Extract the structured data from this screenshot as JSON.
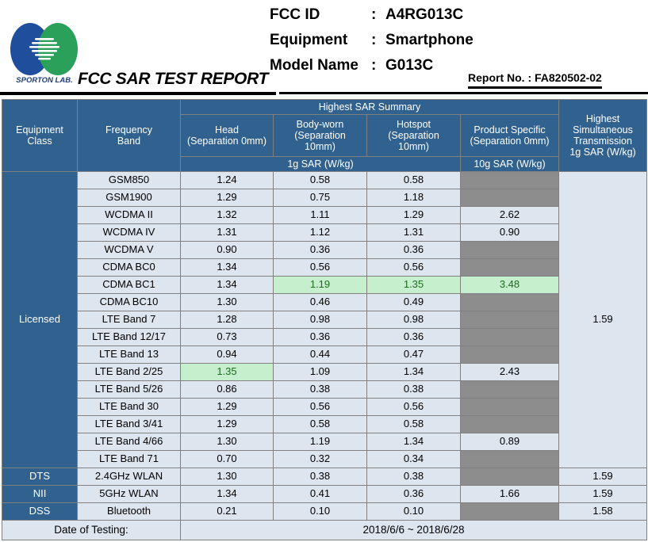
{
  "header": {
    "logo_text": "SPORTON LAB.",
    "logo_colors": {
      "blue": "#1f4e9c",
      "green": "#2aa05a"
    },
    "report_title": "FCC SAR TEST REPORT",
    "info": [
      {
        "label": "FCC ID",
        "colon": ":",
        "value": "A4RG013C"
      },
      {
        "label": "Equipment",
        "colon": ":",
        "value": "Smartphone"
      },
      {
        "label": "Model Name",
        "colon": ":",
        "value": "G013C"
      }
    ],
    "report_no": "Report No. : FA820502-02"
  },
  "table": {
    "group_header": "Highest SAR Summary",
    "columns": {
      "equipment_class": "Equipment\nClass",
      "equipment_class_l1": "Equipment",
      "equipment_class_l2": "Class",
      "frequency_band_l1": "Frequency",
      "frequency_band_l2": "Band",
      "head_l1": "Head",
      "head_l2": "(Separation 0mm)",
      "bodyworn_l1": "Body-worn",
      "bodyworn_l2": "(Separation",
      "bodyworn_l3": "10mm)",
      "hotspot_l1": "Hotspot",
      "hotspot_l2": "(Separation",
      "hotspot_l3": "10mm)",
      "product_specific_l1": "Product Specific",
      "product_specific_l2": "(Separation 0mm)",
      "simultaneous_l1": "Highest",
      "simultaneous_l2": "Simultaneous",
      "simultaneous_l3": "Transmission",
      "simultaneous_l4": "1g SAR (W/kg)"
    },
    "unit_1g": "1g SAR (W/kg)",
    "unit_10g": "10g SAR (W/kg)",
    "classes": {
      "licensed": "Licensed",
      "dts": "DTS",
      "nii": "NII",
      "dss": "DSS"
    },
    "simultaneous_values": {
      "licensed": "1.59",
      "dts": "1.59",
      "nii": "1.59",
      "dss": "1.58"
    },
    "rows": [
      {
        "band": "GSM850",
        "head": "1.24",
        "body": "0.58",
        "hotspot": "0.58",
        "product": "",
        "product_gray": true
      },
      {
        "band": "GSM1900",
        "head": "1.29",
        "body": "0.75",
        "hotspot": "1.18",
        "product": "",
        "product_gray": true
      },
      {
        "band": "WCDMA II",
        "head": "1.32",
        "body": "1.11",
        "hotspot": "1.29",
        "product": "2.62",
        "product_gray": false
      },
      {
        "band": "WCDMA IV",
        "head": "1.31",
        "body": "1.12",
        "hotspot": "1.31",
        "product": "0.90",
        "product_gray": false
      },
      {
        "band": "WCDMA V",
        "head": "0.90",
        "body": "0.36",
        "hotspot": "0.36",
        "product": "",
        "product_gray": true
      },
      {
        "band": "CDMA BC0",
        "head": "1.34",
        "body": "0.56",
        "hotspot": "0.56",
        "product": "",
        "product_gray": true
      },
      {
        "band": "CDMA BC1",
        "head": "1.34",
        "body": "1.19",
        "hotspot": "1.35",
        "product": "3.48",
        "product_gray": false,
        "highlight": [
          "body",
          "hotspot",
          "product"
        ]
      },
      {
        "band": "CDMA BC10",
        "head": "1.30",
        "body": "0.46",
        "hotspot": "0.49",
        "product": "",
        "product_gray": true
      },
      {
        "band": "LTE Band 7",
        "head": "1.28",
        "body": "0.98",
        "hotspot": "0.98",
        "product": "",
        "product_gray": true
      },
      {
        "band": "LTE Band 12/17",
        "head": "0.73",
        "body": "0.36",
        "hotspot": "0.36",
        "product": "",
        "product_gray": true
      },
      {
        "band": "LTE Band 13",
        "head": "0.94",
        "body": "0.44",
        "hotspot": "0.47",
        "product": "",
        "product_gray": true
      },
      {
        "band": "LTE Band 2/25",
        "head": "1.35",
        "body": "1.09",
        "hotspot": "1.34",
        "product": "2.43",
        "product_gray": false,
        "highlight": [
          "head"
        ]
      },
      {
        "band": "LTE Band 5/26",
        "head": "0.86",
        "body": "0.38",
        "hotspot": "0.38",
        "product": "",
        "product_gray": true
      },
      {
        "band": "LTE Band 30",
        "head": "1.29",
        "body": "0.56",
        "hotspot": "0.56",
        "product": "",
        "product_gray": true
      },
      {
        "band": "LTE Band 3/41",
        "head": "1.29",
        "body": "0.58",
        "hotspot": "0.58",
        "product": "",
        "product_gray": true
      },
      {
        "band": "LTE Band 4/66",
        "head": "1.30",
        "body": "1.19",
        "hotspot": "1.34",
        "product": "0.89",
        "product_gray": false
      },
      {
        "band": "LTE Band 71",
        "head": "0.70",
        "body": "0.32",
        "hotspot": "0.34",
        "product": "",
        "product_gray": true
      },
      {
        "band": "2.4GHz WLAN",
        "head": "1.30",
        "body": "0.38",
        "hotspot": "0.38",
        "product": "",
        "product_gray": true
      },
      {
        "band": "5GHz WLAN",
        "head": "1.34",
        "body": "0.41",
        "hotspot": "0.36",
        "product": "1.66",
        "product_gray": false
      },
      {
        "band": "Bluetooth",
        "head": "0.21",
        "body": "0.10",
        "hotspot": "0.10",
        "product": "",
        "product_gray": true
      }
    ],
    "date_label": "Date of Testing:",
    "date_value": "2018/6/6 ~ 2018/6/28"
  }
}
